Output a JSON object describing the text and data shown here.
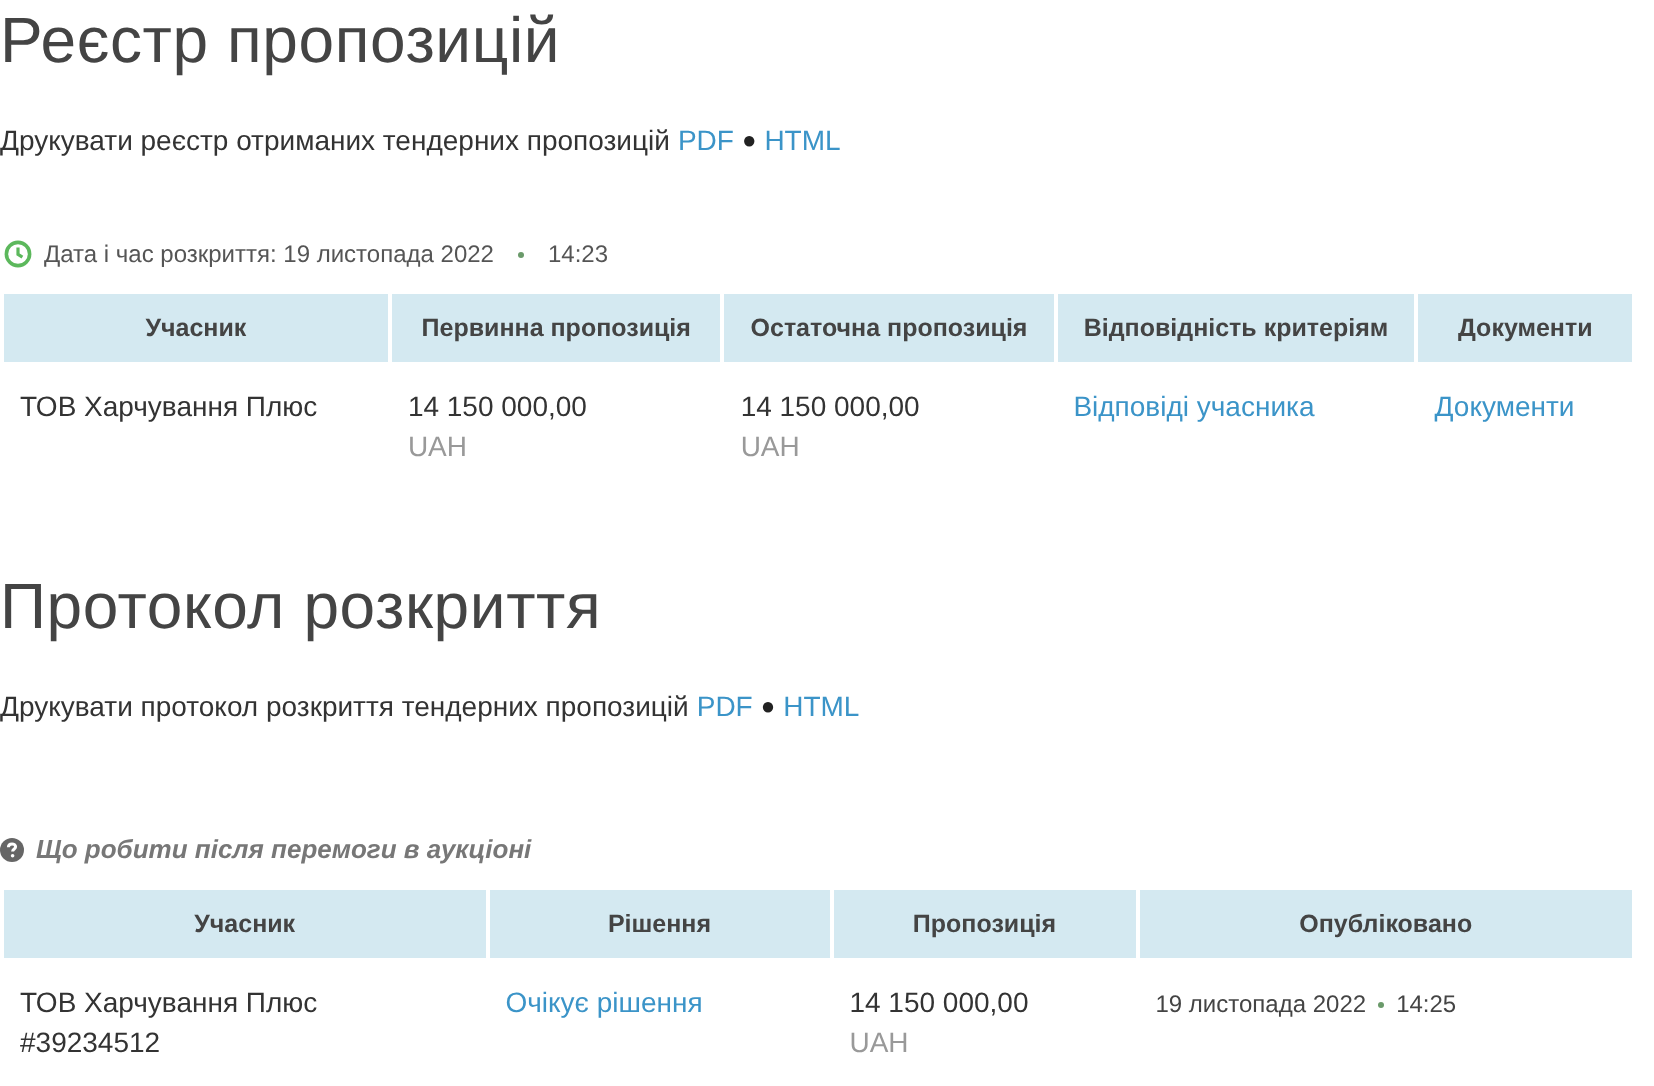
{
  "sections": [
    {
      "title": "Реєстр пропозицій",
      "print": {
        "text": "Друкувати реєстр отриманих тендерних пропозицій",
        "links": [
          {
            "label": "PDF"
          },
          {
            "label": "HTML"
          }
        ],
        "separator": "●"
      },
      "meta": {
        "kind": "date",
        "label": "Дата і час розкриття: 19 листопада 2022",
        "time": "14:23"
      },
      "table": {
        "columns": [
          {
            "label": "Учасник"
          },
          {
            "label": "Первинна пропозиція"
          },
          {
            "label": "Остаточна пропозиція"
          },
          {
            "label": "Відповідність критеріям"
          },
          {
            "label": "Документи"
          }
        ],
        "rows": [
          {
            "cells": [
              {
                "kind": "text",
                "text": "ТОВ Харчування Плюс"
              },
              {
                "kind": "amount",
                "amount": "14 150 000,00",
                "currency": "UAH"
              },
              {
                "kind": "amount",
                "amount": "14 150 000,00",
                "currency": "UAH"
              },
              {
                "kind": "link",
                "text": "Відповіді учасника"
              },
              {
                "kind": "link",
                "text": "Документи"
              }
            ]
          }
        ]
      }
    },
    {
      "title": "Протокол розкриття",
      "print": {
        "text": "Друкувати протокол розкриття тендерних пропозицій",
        "links": [
          {
            "label": "PDF"
          },
          {
            "label": "HTML"
          }
        ],
        "separator": "●"
      },
      "meta": {
        "kind": "help",
        "label": "Що робити після перемоги в аукціоні"
      },
      "table": {
        "columns": [
          {
            "label": "Учасник"
          },
          {
            "label": "Рішення"
          },
          {
            "label": "Пропозиція"
          },
          {
            "label": "Опубліковано"
          }
        ],
        "rows": [
          {
            "cells": [
              {
                "kind": "participant",
                "text": "ТОВ Харчування Плюс",
                "code": "#39234512"
              },
              {
                "kind": "link",
                "text": "Очікує рішення"
              },
              {
                "kind": "amount",
                "amount": "14 150 000,00",
                "currency": "UAH"
              },
              {
                "kind": "datetime",
                "date": "19 листопада 2022",
                "time": "14:25"
              }
            ]
          }
        ]
      }
    }
  ]
}
